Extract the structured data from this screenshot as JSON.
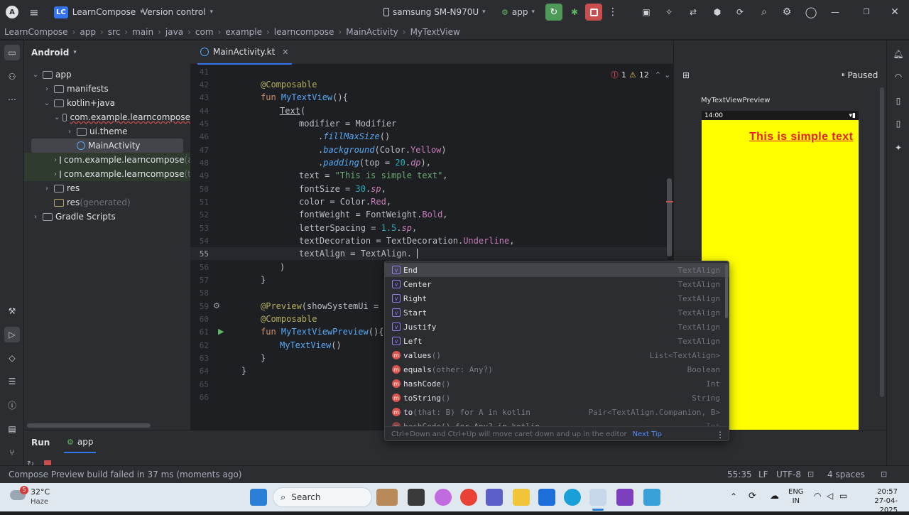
{
  "titlebar": {
    "project": "LearnCompose",
    "project_badge": "LC",
    "vcs": "Version control",
    "device": "samsung SM-N970U",
    "run_config": "app"
  },
  "breadcrumbs": [
    "LearnCompose",
    "app",
    "src",
    "main",
    "java",
    "com",
    "example",
    "learncompose",
    "MainActivity",
    "MyTextView"
  ],
  "project_panel": {
    "title": "Android",
    "tree": [
      {
        "label": "app",
        "indent": 0,
        "chev": "v"
      },
      {
        "label": "manifests",
        "indent": 1,
        "chev": ">"
      },
      {
        "label": "kotlin+java",
        "indent": 1,
        "chev": "v"
      },
      {
        "label": "com.example.learncompose",
        "indent": 2,
        "chev": "v"
      },
      {
        "label": "ui.theme",
        "indent": 3,
        "chev": ">"
      },
      {
        "label": "MainActivity",
        "indent": 3,
        "chev": ""
      },
      {
        "label": "com.example.learncompose",
        "suffix": "(an",
        "indent": 2,
        "chev": ">"
      },
      {
        "label": "com.example.learncompose",
        "suffix": "(te",
        "indent": 2,
        "chev": ">"
      },
      {
        "label": "res",
        "indent": 1,
        "chev": ">"
      },
      {
        "label": "res",
        "suffix": "(generated)",
        "indent": 1,
        "chev": ""
      },
      {
        "label": "Gradle Scripts",
        "indent": 0,
        "chev": ">"
      }
    ]
  },
  "editor": {
    "tab": "MainActivity.kt",
    "errors": "1",
    "warnings": "12",
    "current_line": "55"
  },
  "preview": {
    "status": "Paused",
    "name": "MyTextViewPreview",
    "device_time": "14:00",
    "text": "This is simple text",
    "bg": "#ffff00",
    "text_color": "#ff0000"
  },
  "completion": {
    "items": [
      {
        "kind": "v",
        "name": "End",
        "args": "",
        "type": "TextAlign"
      },
      {
        "kind": "v",
        "name": "Center",
        "args": "",
        "type": "TextAlign"
      },
      {
        "kind": "v",
        "name": "Right",
        "args": "",
        "type": "TextAlign"
      },
      {
        "kind": "v",
        "name": "Start",
        "args": "",
        "type": "TextAlign"
      },
      {
        "kind": "v",
        "name": "Justify",
        "args": "",
        "type": "TextAlign"
      },
      {
        "kind": "v",
        "name": "Left",
        "args": "",
        "type": "TextAlign"
      },
      {
        "kind": "m",
        "name": "values",
        "args": "()",
        "type": "List<TextAlign>"
      },
      {
        "kind": "m",
        "name": "equals",
        "args": "(other: Any?)",
        "type": "Boolean"
      },
      {
        "kind": "m",
        "name": "hashCode",
        "args": "()",
        "type": "Int"
      },
      {
        "kind": "m",
        "name": "toString",
        "args": "()",
        "type": "String"
      },
      {
        "kind": "m",
        "name": "to",
        "args": "(that: B) for A in kotlin",
        "type": "Pair<TextAlign.Companion, B>"
      }
    ],
    "partial": "hashCode() for Any? in kotlin",
    "partial_type": "Int",
    "hint": "Ctrl+Down and Ctrl+Up will move caret down and up in the editor",
    "next_tip": "Next Tip"
  },
  "run_panel": {
    "label": "Run",
    "tab": "app"
  },
  "statusbar": {
    "message": "Compose Preview build failed in 37 ms (moments ago)",
    "position": "55:35",
    "line_sep": "LF",
    "encoding": "UTF-8",
    "indent": "4 spaces"
  },
  "taskbar": {
    "temp": "32°C",
    "weather": "Haze",
    "weather_badge": "5",
    "search": "Search",
    "lang1": "ENG",
    "lang2": "IN",
    "time": "20:57",
    "date": "27-04-2025"
  }
}
